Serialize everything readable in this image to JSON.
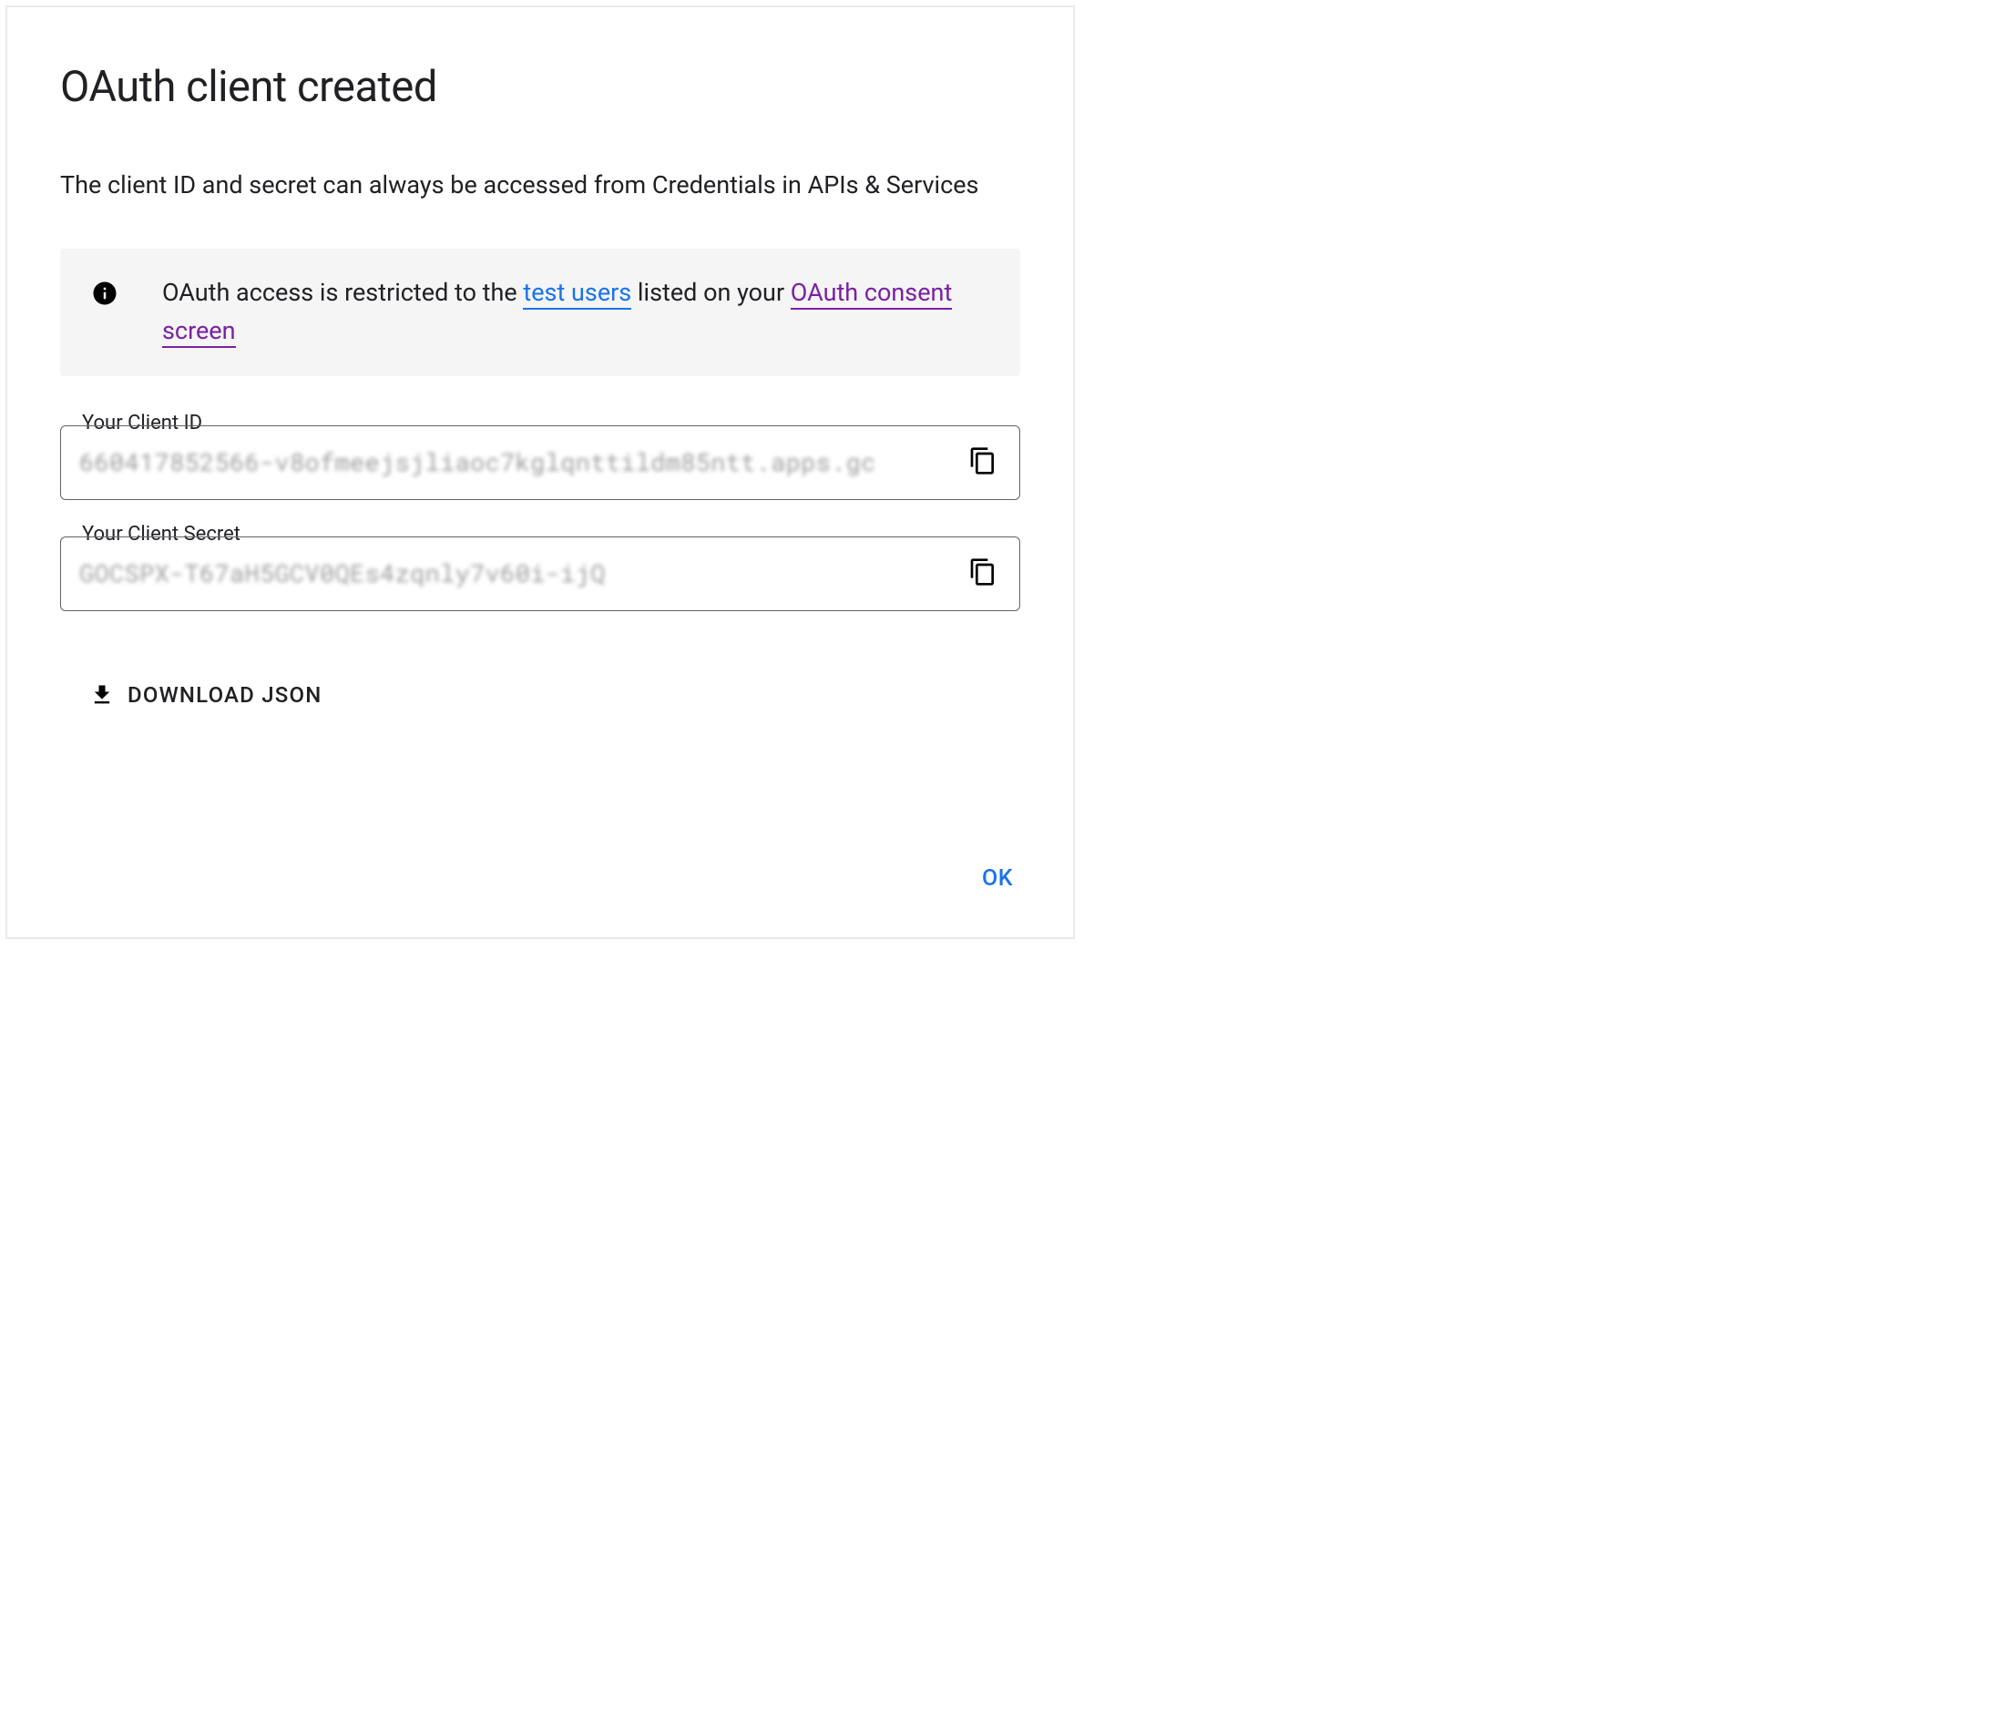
{
  "dialog": {
    "title": "OAuth client created",
    "subtitle": "The client ID and secret can always be accessed from Credentials in APIs & Services",
    "info": {
      "text_before": "OAuth access is restricted to the ",
      "link_testusers": "test users",
      "text_middle": " listed on your ",
      "link_consent": "OAuth consent screen"
    },
    "client_id": {
      "label": "Your Client ID",
      "value": "660417852566-v8ofmeejsjliaoc7kglqnttildm85ntt.apps.gc"
    },
    "client_secret": {
      "label": "Your Client Secret",
      "value": "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"
    },
    "download_label": "DOWNLOAD JSON",
    "ok_label": "OK"
  }
}
